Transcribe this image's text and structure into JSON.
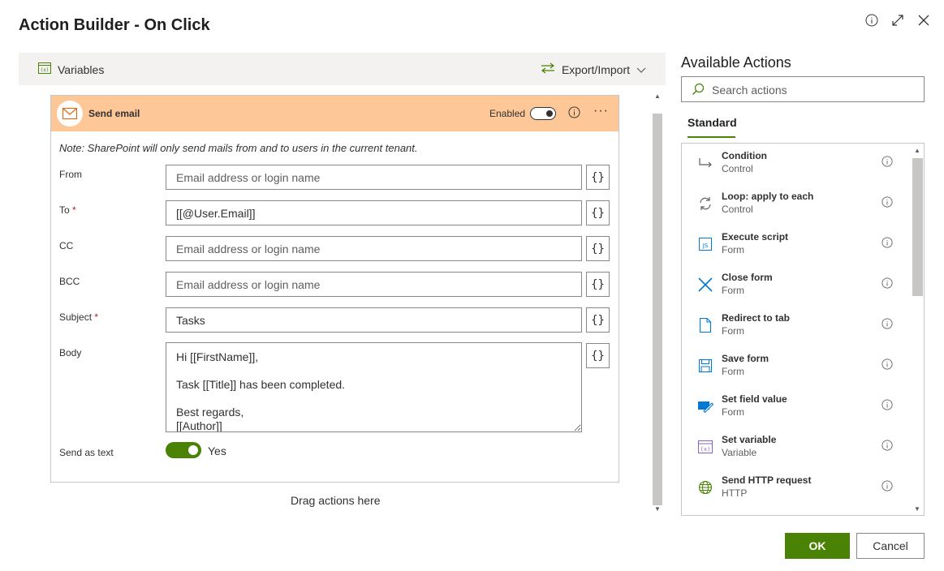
{
  "dialog": {
    "title": "Action Builder - On Click"
  },
  "toolbar": {
    "variables_label": "Variables",
    "export_import_label": "Export/Import"
  },
  "action_card": {
    "title": "Send email",
    "enabled_label": "Enabled",
    "enabled": true,
    "note": "Note: SharePoint will only send mails from and to users in the current tenant.",
    "fields": {
      "from": {
        "label": "From",
        "value": "",
        "placeholder": "Email address or login name"
      },
      "to": {
        "label": "To",
        "required_mark": "*",
        "value": "[[@User.Email]]",
        "placeholder": "Email address or login name"
      },
      "cc": {
        "label": "CC",
        "value": "",
        "placeholder": "Email address or login name"
      },
      "bcc": {
        "label": "BCC",
        "value": "",
        "placeholder": "Email address or login name"
      },
      "subject": {
        "label": "Subject",
        "required_mark": "*",
        "value": "Tasks"
      },
      "body": {
        "label": "Body",
        "value": "Hi [[FirstName]],\n\nTask [[Title]] has been completed.\n\nBest regards,\n[[Author]]"
      }
    },
    "brace_label": "{}",
    "send_as_text": {
      "label": "Send as text",
      "state_label": "Yes",
      "on": true
    }
  },
  "drag_hint": "Drag actions here",
  "available": {
    "title": "Available Actions",
    "search_placeholder": "Search actions",
    "tab": "Standard",
    "items": [
      {
        "name": "Condition",
        "category": "Control",
        "icon": "condition-icon"
      },
      {
        "name": "Loop: apply to each",
        "category": "Control",
        "icon": "loop-icon"
      },
      {
        "name": "Execute script",
        "category": "Form",
        "icon": "js-icon"
      },
      {
        "name": "Close form",
        "category": "Form",
        "icon": "close-x-icon"
      },
      {
        "name": "Redirect to tab",
        "category": "Form",
        "icon": "page-icon"
      },
      {
        "name": "Save form",
        "category": "Form",
        "icon": "save-icon"
      },
      {
        "name": "Set field value",
        "category": "Form",
        "icon": "edit-field-icon"
      },
      {
        "name": "Set variable",
        "category": "Variable",
        "icon": "variable-icon"
      },
      {
        "name": "Send HTTP request",
        "category": "HTTP",
        "icon": "globe-icon"
      }
    ]
  },
  "buttons": {
    "ok": "OK",
    "cancel": "Cancel"
  },
  "colors": {
    "accent_green": "#498205",
    "card_header": "#fdc798",
    "toolbar_bg": "#f3f2f1"
  }
}
